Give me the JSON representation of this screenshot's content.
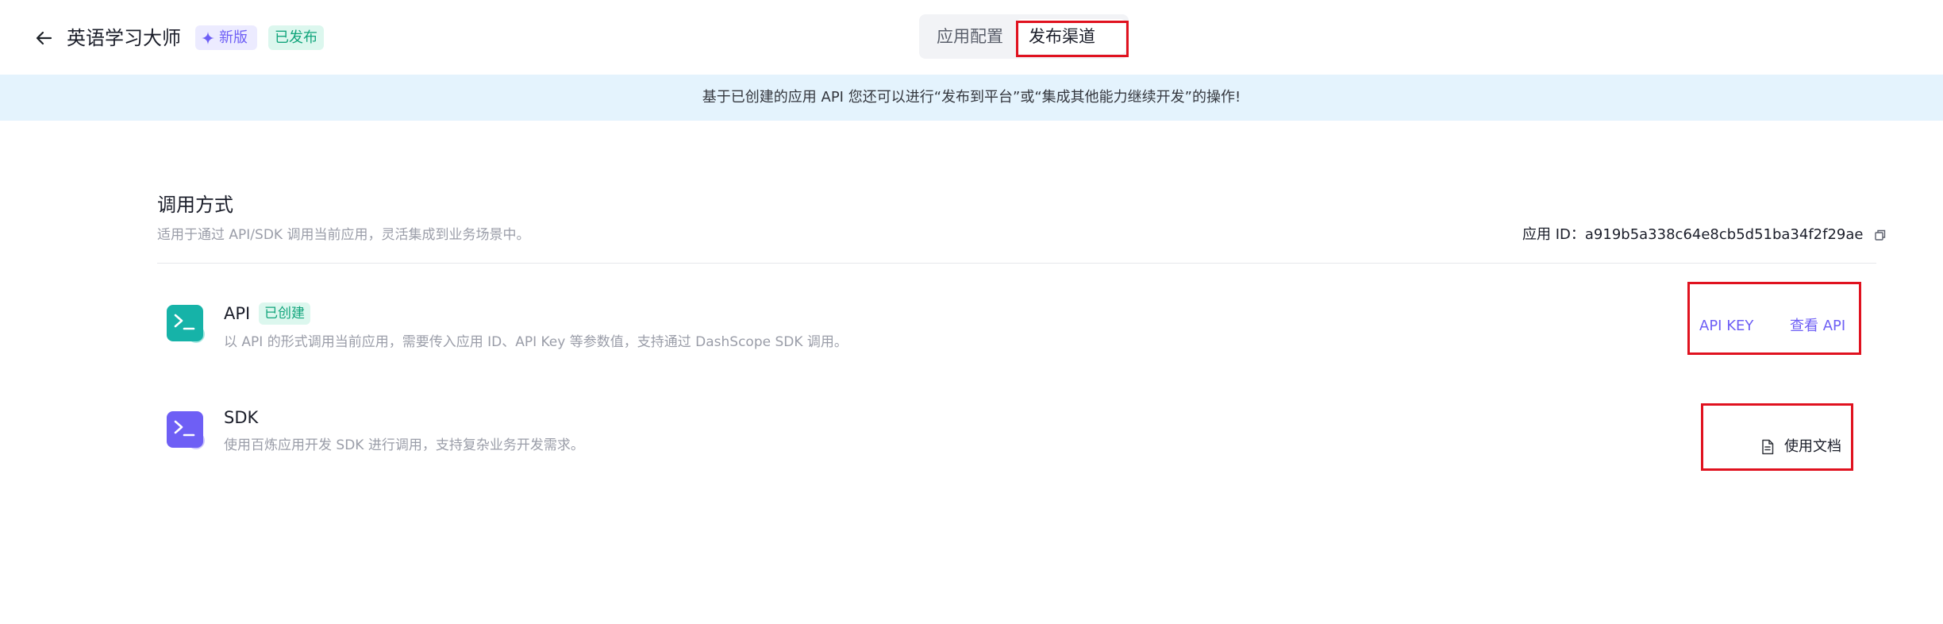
{
  "header": {
    "app_title": "英语学习大师",
    "badge_new": "新版",
    "badge_published": "已发布",
    "tabs": [
      {
        "label": "应用配置",
        "active": false
      },
      {
        "label": "发布渠道",
        "active": true
      }
    ]
  },
  "banner": {
    "text": "基于已创建的应用 API 您还可以进行“发布到平台”或“集成其他能力继续开发”的操作!"
  },
  "section": {
    "title": "调用方式",
    "description": "适用于通过 API/SDK 调用当前应用，灵活集成到业务场景中。",
    "app_id_label": "应用 ID：",
    "app_id_value": "a919b5a338c64e8cb5d51ba34f2f29ae"
  },
  "items": [
    {
      "title": "API",
      "tag": "已创建",
      "description": "以 API 的形式调用当前应用，需要传入应用 ID、API Key 等参数值，支持通过 DashScope SDK 调用。",
      "actions": [
        "API KEY",
        "查看 API"
      ]
    },
    {
      "title": "SDK",
      "description": "使用百炼应用开发 SDK 进行调用，支持复杂业务开发需求。",
      "actions": [
        "使用文档"
      ]
    }
  ],
  "colors": {
    "accent": "#6e5ff5",
    "success": "#12a57c",
    "banner_bg": "#e4f3fd",
    "api_icon": "#16b3a8",
    "sdk_icon": "#6e5ff5",
    "highlight_box": "#e0121f"
  },
  "icons": [
    "arrow-left-icon",
    "sparkle-icon",
    "copy-icon",
    "terminal-icon",
    "document-icon"
  ]
}
